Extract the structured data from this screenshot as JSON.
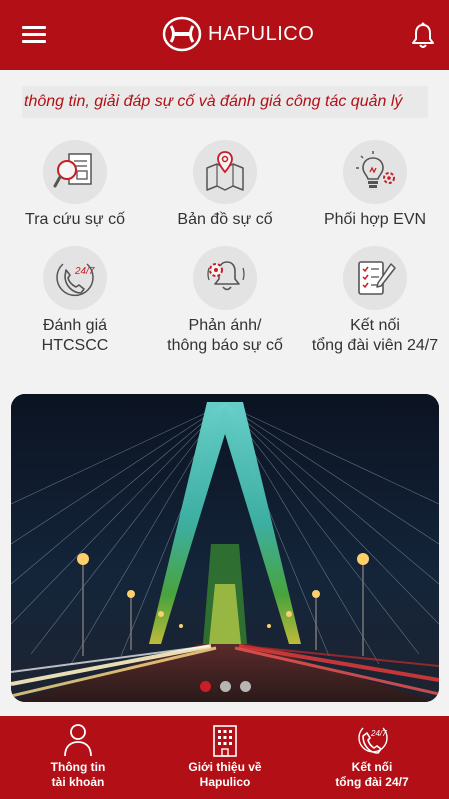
{
  "header": {
    "brand": "HAPULICO"
  },
  "marquee": {
    "text": "thông tin, giải đáp sự cố và đánh giá công tác quản lý"
  },
  "services": [
    {
      "label": "Tra cứu sự cố",
      "icon": "search-document-icon"
    },
    {
      "label": "Bản đồ sự cố",
      "icon": "map-pin-icon"
    },
    {
      "label": "Phối hợp EVN",
      "icon": "lightbulb-gear-icon"
    },
    {
      "label_line1": "Đánh giá",
      "label_line2": "HTCSCC",
      "icon": "phone-24-7-icon",
      "icon_text": "24/7"
    },
    {
      "label_line1": "Phản ánh/",
      "label_line2": "thông báo sự cố",
      "icon": "bell-gear-icon"
    },
    {
      "label_line1": "Kết nối",
      "label_line2": "tổng đài viên 24/7",
      "icon": "checklist-pen-icon"
    }
  ],
  "banner": {
    "slides": 3,
    "active_slide": 1
  },
  "footer": {
    "items": [
      {
        "line1": "Thông tin",
        "line2": "tài khoản",
        "icon": "user-icon"
      },
      {
        "line1": "Giới thiệu về",
        "line2": "Hapulico",
        "icon": "building-icon"
      },
      {
        "line1": "Kết nối",
        "line2": "tổng đài 24/7",
        "icon": "phone-24-7-icon",
        "icon_text": "24/7"
      }
    ]
  },
  "colors": {
    "brand_red": "#b30f16",
    "accent_red": "#c81e25",
    "icon_bg": "#e3e3e3"
  }
}
